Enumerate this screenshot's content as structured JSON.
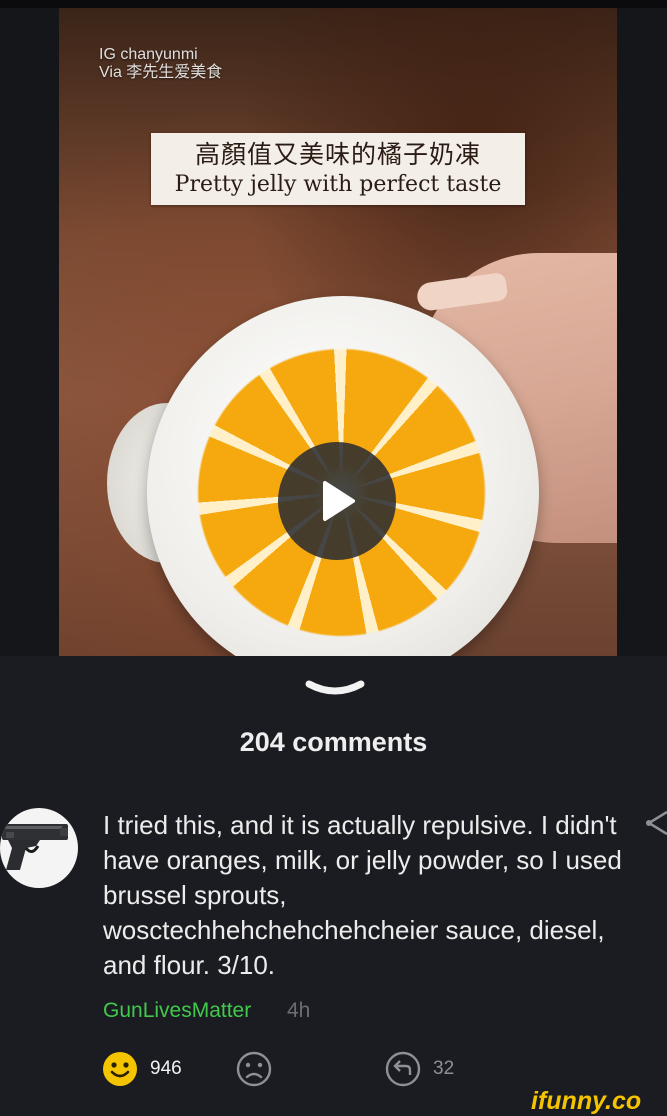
{
  "video": {
    "watermark_line1": "IG chanyunmi",
    "watermark_line2": "Via 李先生爱美食",
    "caption_chinese": "高顏值又美味的橘子奶凍",
    "caption_english": "Pretty jelly with perfect taste"
  },
  "comments_header": "204 comments",
  "comment": {
    "text": "I tried this, and it is actually repulsive. I didn't have oranges, milk, or jelly powder, so I used brussel sprouts, wosctechhehchehchehcheier sauce, diesel, and flour. 3/10.",
    "username": "GunLivesMatter",
    "timestamp": "4h",
    "like_count": "946",
    "reply_count": "32"
  },
  "brand": "ifunny.co",
  "colors": {
    "background": "#1b1c21",
    "username_green": "#40c94b",
    "smile_yellow": "#f5c400"
  },
  "icons": [
    "play-icon",
    "chevron-down-icon",
    "pistol-avatar-icon",
    "share-icon",
    "smile-icon",
    "frown-icon",
    "reply-icon"
  ]
}
